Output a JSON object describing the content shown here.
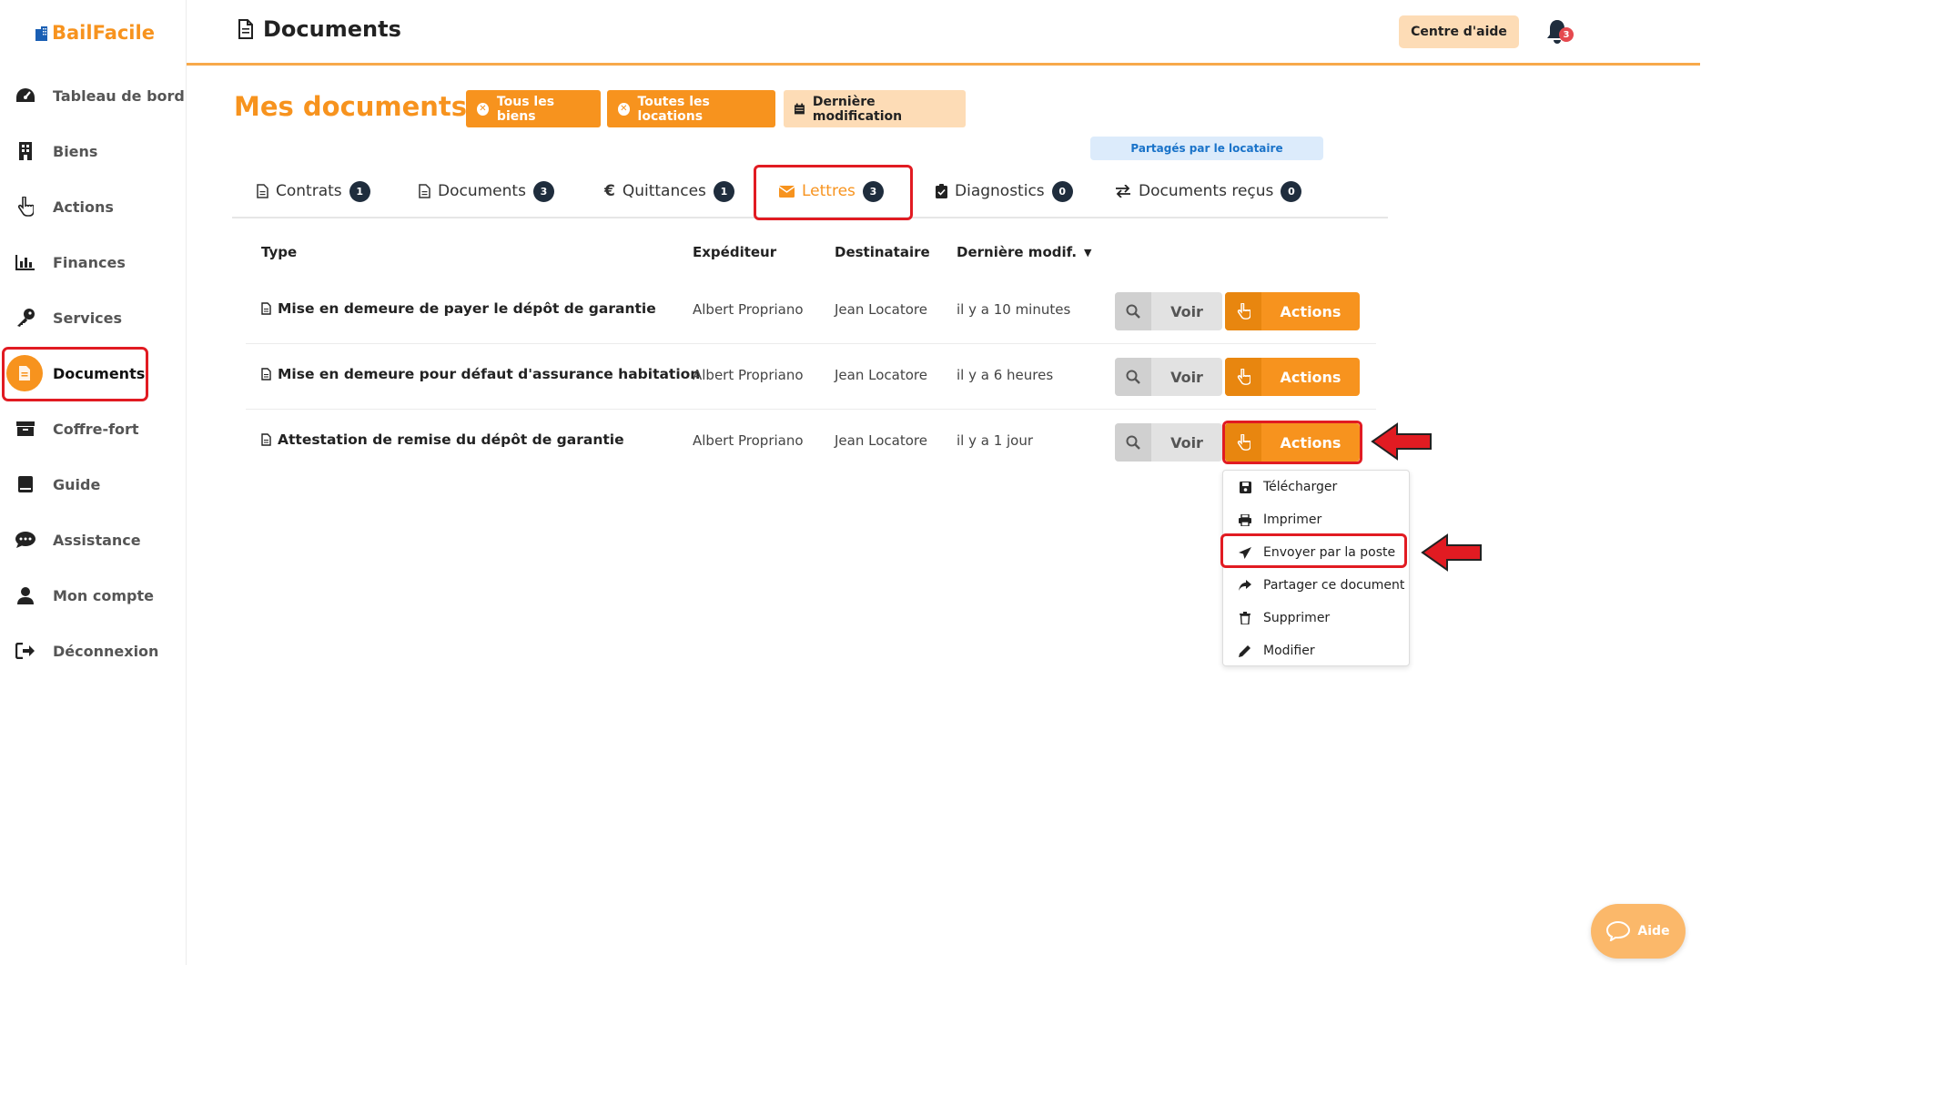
{
  "app": {
    "brand": "BailFacile"
  },
  "sidebar": {
    "items": [
      {
        "label": "Tableau de bord",
        "icon": "dashboard-icon"
      },
      {
        "label": "Biens",
        "icon": "building-icon"
      },
      {
        "label": "Actions",
        "icon": "hand-pointer-icon"
      },
      {
        "label": "Finances",
        "icon": "bar-chart-icon"
      },
      {
        "label": "Services",
        "icon": "key-icon"
      },
      {
        "label": "Documents",
        "icon": "document-icon",
        "active": true
      },
      {
        "label": "Coffre-fort",
        "icon": "archive-icon"
      },
      {
        "label": "Guide",
        "icon": "book-icon"
      },
      {
        "label": "Assistance",
        "icon": "chat-icon"
      },
      {
        "label": "Mon compte",
        "icon": "user-icon"
      },
      {
        "label": "Déconnexion",
        "icon": "logout-icon"
      }
    ]
  },
  "header": {
    "title": "Documents",
    "help_label": "Centre d'aide",
    "notification_count": "3"
  },
  "main": {
    "title": "Mes documents",
    "filters": [
      {
        "label": "Tous les biens"
      },
      {
        "label": "Toutes les locations"
      },
      {
        "label": "Dernière modification"
      }
    ],
    "shared_badge": "Partagés par le locataire",
    "tabs": [
      {
        "label": "Contrats",
        "count": "1",
        "icon": "file-icon"
      },
      {
        "label": "Documents",
        "count": "3",
        "icon": "file-icon"
      },
      {
        "label": "Quittances",
        "count": "1",
        "icon": "euro-icon"
      },
      {
        "label": "Lettres",
        "count": "3",
        "icon": "envelope-icon",
        "active": true
      },
      {
        "label": "Diagnostics",
        "count": "0",
        "icon": "clipboard-check-icon"
      },
      {
        "label": "Documents reçus",
        "count": "0",
        "icon": "exchange-icon"
      }
    ]
  },
  "table": {
    "headers": [
      "Type",
      "Expéditeur",
      "Destinataire",
      "Dernière modif."
    ],
    "rows": [
      {
        "type": "Mise en demeure de payer le dépôt de garantie",
        "sender": "Albert Propriano",
        "recipient": "Jean Locatore",
        "modified": "il y a 10 minutes"
      },
      {
        "type": "Mise en demeure pour défaut d'assurance habitation",
        "sender": "Albert Propriano",
        "recipient": "Jean Locatore",
        "modified": "il y a 6 heures"
      },
      {
        "type": "Attestation de remise du dépôt de garantie",
        "sender": "Albert Propriano",
        "recipient": "Jean Locatore",
        "modified": "il y a 1 jour"
      }
    ],
    "view_label": "Voir",
    "actions_label": "Actions"
  },
  "dropdown": {
    "items": [
      {
        "label": "Télécharger",
        "icon": "save-icon"
      },
      {
        "label": "Imprimer",
        "icon": "print-icon"
      },
      {
        "label": "Envoyer par la poste",
        "icon": "send-icon"
      },
      {
        "label": "Partager ce document",
        "icon": "share-icon"
      },
      {
        "label": "Supprimer",
        "icon": "trash-icon"
      },
      {
        "label": "Modifier",
        "icon": "pencil-icon"
      }
    ]
  },
  "aide_button": {
    "label": "Aide"
  },
  "colors": {
    "accent": "#f7931e",
    "highlight": "#e11b22",
    "dark": "#1f2d3d"
  }
}
